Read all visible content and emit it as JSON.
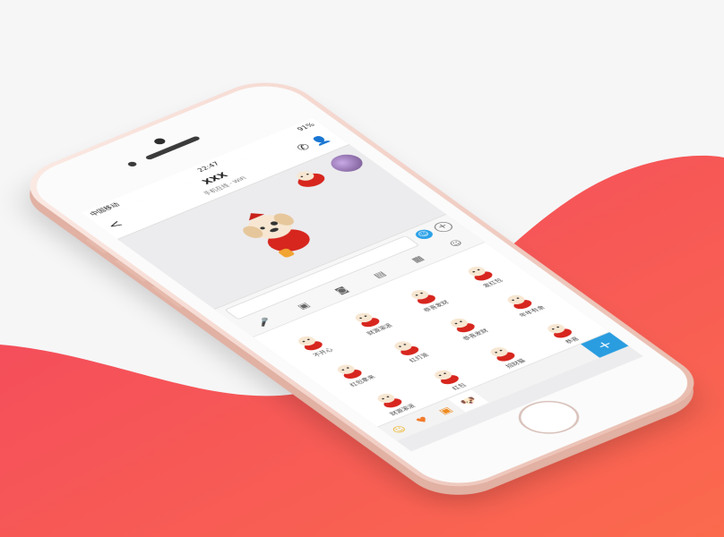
{
  "status": {
    "carrier": "中国移动",
    "time": "22:47",
    "battery": "91%"
  },
  "nav": {
    "back": "<",
    "title": "XXX",
    "subtitle": "手机在线 - WiFi"
  },
  "stickers": [
    {
      "label": "不开心"
    },
    {
      "label": "财源滚滚"
    },
    {
      "label": "恭喜发财"
    },
    {
      "label": "发红包"
    },
    {
      "label": "红包拿来"
    },
    {
      "label": "红灯笼"
    },
    {
      "label": "恭喜发财"
    },
    {
      "label": "年年有余"
    },
    {
      "label": "财源滚滚"
    },
    {
      "label": "红包"
    },
    {
      "label": "招财猫"
    },
    {
      "label": "恭喜"
    }
  ],
  "colors": {
    "bg_red": "#f4445b",
    "bg_orange": "#fb6a4e",
    "accent_blue": "#2a9de0"
  }
}
